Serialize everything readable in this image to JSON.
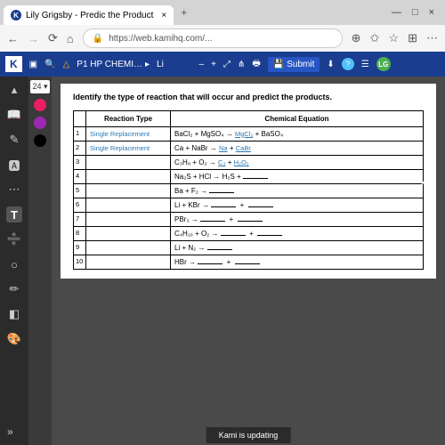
{
  "titlebar": {
    "tab_title": "Lily Grigsby - Predic the Product",
    "plus": "+",
    "min": "—",
    "max": "□",
    "close": "×"
  },
  "address": {
    "back": "←",
    "fwd": "→",
    "reload": "⟳",
    "home": "⌂",
    "lock": "🔒",
    "url": "https://web.kamihq.com/...",
    "add": "⊕",
    "star": "✩",
    "fav": "☆",
    "ext": "⊞",
    "menu": "⋯"
  },
  "toolbar": {
    "k": "K",
    "doc_title": "P1 HP CHEMI…",
    "li": "Li",
    "minus": "–",
    "plus": "+",
    "submit": "Submit",
    "help": "?"
  },
  "lg": "LG",
  "sidebar": {
    "i1": "▴",
    "i2": "📖",
    "i3": "✎",
    "i4": "🅰",
    "i5": "⋯",
    "i6": "T",
    "i7": "➗",
    "i8": "○",
    "i9": "✏",
    "i10": "◧",
    "i11": "🎨"
  },
  "fontsize": "24 ▾",
  "colors": {
    "c1": "#e91e63",
    "c2": "#9c27b0",
    "c3": "#000000"
  },
  "doc": {
    "heading": "Identify the type of reaction that will occur and predict the products.",
    "th1": "Reaction Type",
    "th2": "Chemical Equation",
    "rows": [
      {
        "n": "1",
        "rt": "Single Replacement",
        "eq_pre": "BaCl₂ + MgSO₄ → ",
        "ans1": "MgCl₂",
        "eq_mid": " + BaSO₄"
      },
      {
        "n": "2",
        "rt": "Single Replacement",
        "eq_pre": "Ca + NaBr → ",
        "ans1": "Na",
        "eq_mid": "   +  ",
        "ans2": "CaBr"
      },
      {
        "n": "3",
        "rt": "",
        "eq_pre": "C₃H₈ + O₂ → ",
        "ans1": "C₃",
        "eq_mid": "   +  ",
        "ans2": "H₂O₂"
      },
      {
        "n": "4",
        "rt": "",
        "eq_pre": "Na₂S + HCl → H₂S + ",
        "blank": true
      },
      {
        "n": "5",
        "rt": "",
        "eq_pre": "Ba + F₂ → ",
        "blank": true
      },
      {
        "n": "6",
        "rt": "",
        "eq_pre": "Li + KBr → ",
        "blank2": true
      },
      {
        "n": "7",
        "rt": "",
        "eq_pre": "PBr₃ → ",
        "blank2": true
      },
      {
        "n": "8",
        "rt": "",
        "eq_pre": "C₄H₁₀ + O₂ → ",
        "blank2": true
      },
      {
        "n": "9",
        "rt": "",
        "eq_pre": "Li + N₂ → ",
        "blank": true
      },
      {
        "n": "10",
        "rt": "",
        "eq_pre": "HBr → ",
        "blank2": true
      }
    ]
  },
  "status": "Kami is updating",
  "expand": "»"
}
